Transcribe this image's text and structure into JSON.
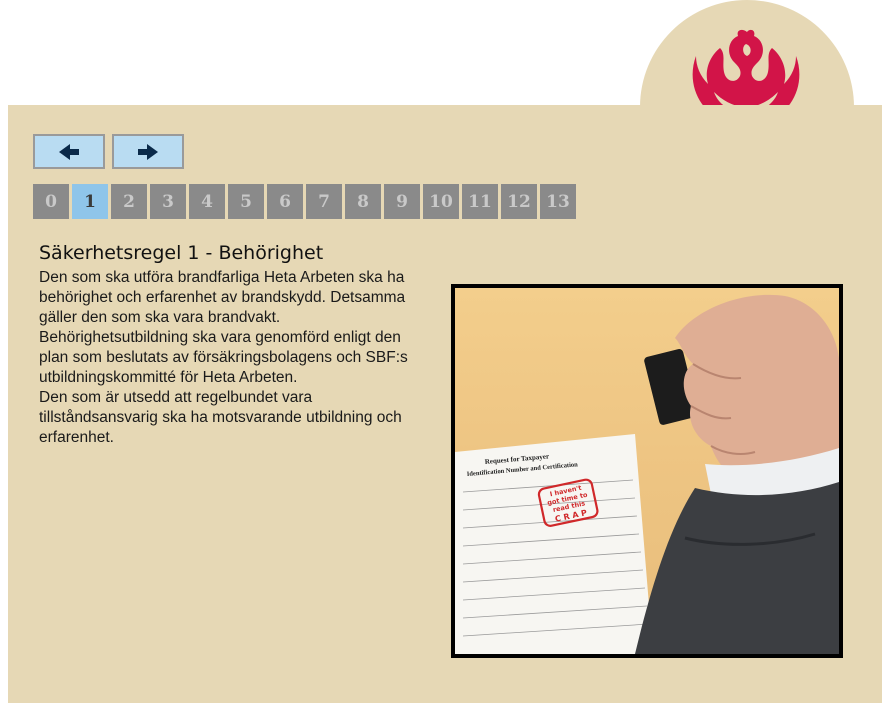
{
  "navigation": {
    "prev_icon": "arrow-left-icon",
    "next_icon": "arrow-right-icon",
    "pages": [
      "0",
      "1",
      "2",
      "3",
      "4",
      "5",
      "6",
      "7",
      "8",
      "9",
      "10",
      "11",
      "12",
      "13"
    ],
    "active_page": "1"
  },
  "content": {
    "title": "Säkerhetsregel 1 - Behörighet",
    "paragraphs": [
      "Den som ska utföra brandfarliga Heta Arbeten ska ha behörighet och erfarenhet av brandskydd. Detsamma gäller den som ska vara brandvakt.",
      "Behörighetsutbildning ska vara genomförd enligt den plan som beslutats av försäkringsbolagens och SBF:s utbildningskommitté för Heta Arbeten.",
      "Den som är utsedd att regelbundet vara tillståndsansvarig ska ha motsvarande utbildning och erfarenhet."
    ]
  },
  "photo": {
    "form_title": "Request for Taxpayer",
    "form_subtitle": "Identification Number and Certification",
    "stamp_lines": [
      "I haven't",
      "got time to",
      "read this",
      "C R A P"
    ]
  },
  "colors": {
    "panel": "#e6d8b5",
    "nav_button": "#b9dcf2",
    "page_button": "#8a8a8a",
    "page_button_active": "#8fc5ea",
    "logo": "#d21448"
  }
}
